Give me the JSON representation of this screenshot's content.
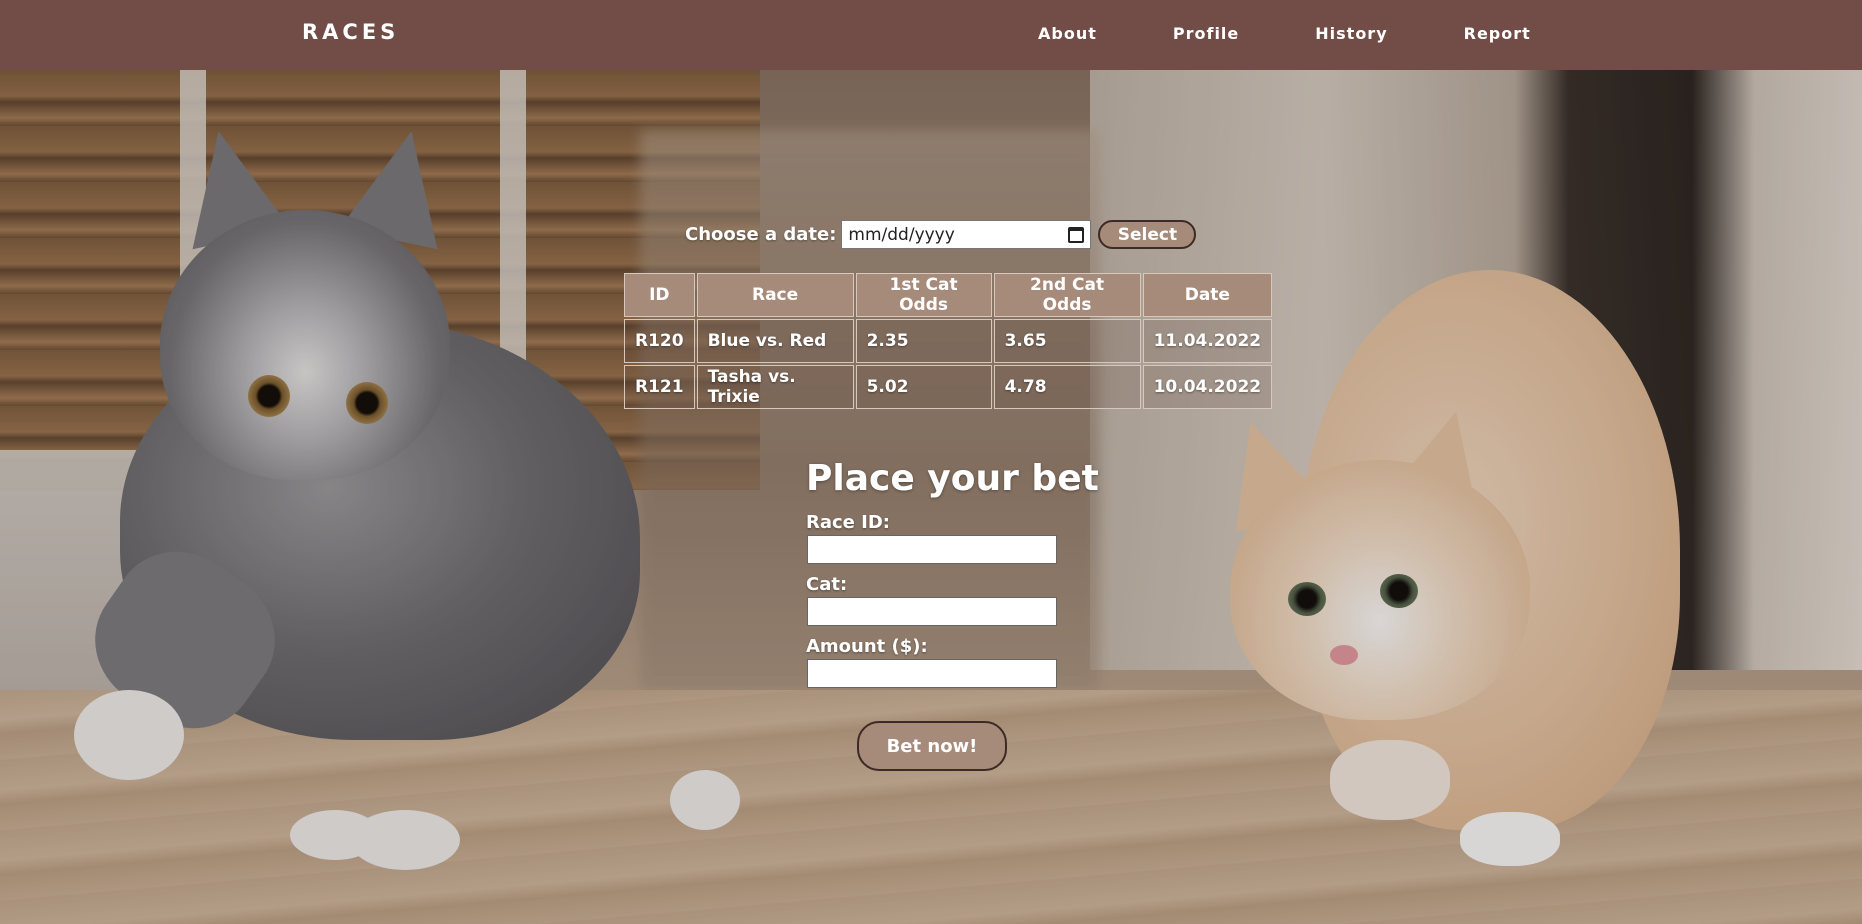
{
  "nav": {
    "brand": "RACES",
    "links": [
      {
        "label": "About"
      },
      {
        "label": "Profile"
      },
      {
        "label": "History"
      },
      {
        "label": "Report"
      }
    ]
  },
  "date_picker": {
    "label": "Choose a date:",
    "placeholder": "mm/dd/yyyy",
    "select_label": "Select"
  },
  "races_table": {
    "headers": [
      "ID",
      "Race",
      "1st Cat Odds",
      "2nd Cat Odds",
      "Date"
    ],
    "rows": [
      [
        "R120",
        "Blue vs. Red",
        "2.35",
        "3.65",
        "11.04.2022"
      ],
      [
        "R121",
        "Tasha vs. Trixie",
        "5.02",
        "4.78",
        "10.04.2022"
      ]
    ]
  },
  "bet_form": {
    "title": "Place your bet",
    "race_id_label": "Race ID:",
    "race_id_value": "",
    "cat_label": "Cat:",
    "cat_value": "",
    "amount_label": "Amount ($):",
    "amount_value": "",
    "submit_label": "Bet now!"
  },
  "colors": {
    "navbar": "#724c47",
    "button": "#a68a7a",
    "button_border": "#3d2a24"
  }
}
